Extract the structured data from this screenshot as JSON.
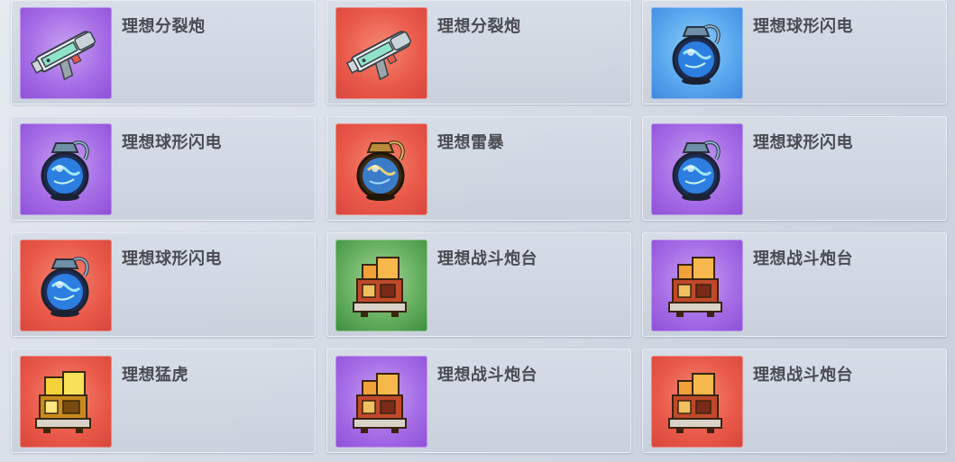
{
  "colors": {
    "purple": "#a66de6",
    "red": "#ea5a4a",
    "blue": "#5aa8ef",
    "green": "#66b060",
    "text": "#4a4c52"
  },
  "items": [
    {
      "name": "理想分裂炮",
      "rarity": "purple",
      "icon": "split-cannon-icon"
    },
    {
      "name": "理想分裂炮",
      "rarity": "red",
      "icon": "split-cannon-icon"
    },
    {
      "name": "理想球形闪电",
      "rarity": "blue",
      "icon": "ball-lightning-grenade-icon"
    },
    {
      "name": "理想球形闪电",
      "rarity": "purple",
      "icon": "ball-lightning-grenade-icon"
    },
    {
      "name": "理想雷暴",
      "rarity": "red",
      "icon": "thunderstorm-grenade-icon"
    },
    {
      "name": "理想球形闪电",
      "rarity": "purple",
      "icon": "ball-lightning-grenade-icon"
    },
    {
      "name": "理想球形闪电",
      "rarity": "red",
      "icon": "ball-lightning-grenade-icon"
    },
    {
      "name": "理想战斗炮台",
      "rarity": "green",
      "icon": "battle-turret-icon"
    },
    {
      "name": "理想战斗炮台",
      "rarity": "purple",
      "icon": "battle-turret-icon"
    },
    {
      "name": "理想猛虎",
      "rarity": "red",
      "icon": "tiger-turret-icon"
    },
    {
      "name": "理想战斗炮台",
      "rarity": "purple",
      "icon": "battle-turret-icon"
    },
    {
      "name": "理想战斗炮台",
      "rarity": "red",
      "icon": "battle-turret-icon"
    }
  ]
}
